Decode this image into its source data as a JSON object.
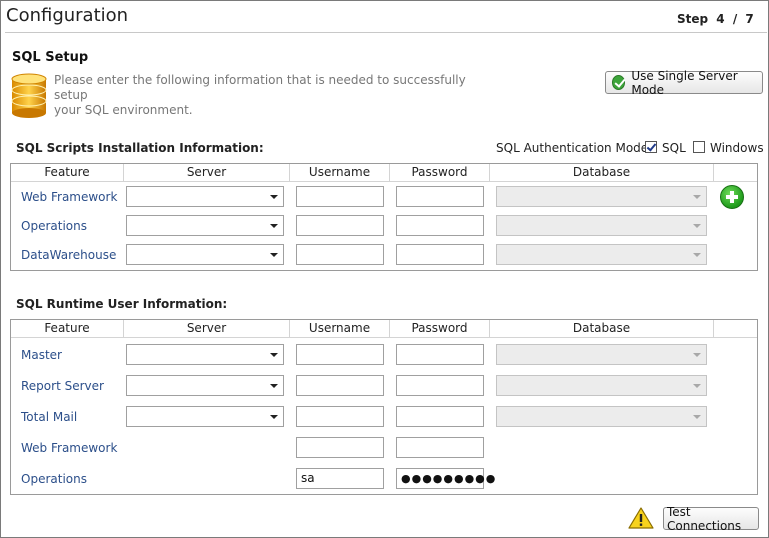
{
  "header": {
    "title": "Configuration",
    "step_label": "Step",
    "step_current": "4",
    "step_sep": "/",
    "step_total": "7"
  },
  "sql_setup": {
    "title": "SQL Setup",
    "desc_line1": "Please enter the following information that is needed to successfully setup",
    "desc_line2": "your SQL environment.",
    "single_server_label": "Use Single Server Mode"
  },
  "scripts": {
    "label": "SQL Scripts Installation Information:",
    "auth_label": "SQL Authentication Mode:",
    "auth_sql": "SQL",
    "auth_windows": "Windows",
    "columns": {
      "feature": "Feature",
      "server": "Server",
      "username": "Username",
      "password": "Password",
      "database": "Database"
    },
    "rows": [
      {
        "feature": "Web Framework",
        "username": "",
        "password": ""
      },
      {
        "feature": "Operations",
        "username": "",
        "password": ""
      },
      {
        "feature": "DataWarehouse",
        "username": "",
        "password": ""
      }
    ]
  },
  "runtime": {
    "label": "SQL Runtime User Information:",
    "columns": {
      "feature": "Feature",
      "server": "Server",
      "username": "Username",
      "password": "Password",
      "database": "Database"
    },
    "rows": [
      {
        "feature": "Master",
        "username": "",
        "password": ""
      },
      {
        "feature": "Report Server",
        "username": "",
        "password": ""
      },
      {
        "feature": "Total Mail",
        "username": "",
        "password": ""
      },
      {
        "feature": "Web Framework",
        "username": "",
        "password": ""
      },
      {
        "feature": "Operations",
        "username": "sa",
        "password": "●●●●●●●●●"
      }
    ]
  },
  "footer": {
    "test_label": "Test Connections"
  },
  "state": {
    "auth_sql_checked": true,
    "auth_windows_checked": false
  }
}
